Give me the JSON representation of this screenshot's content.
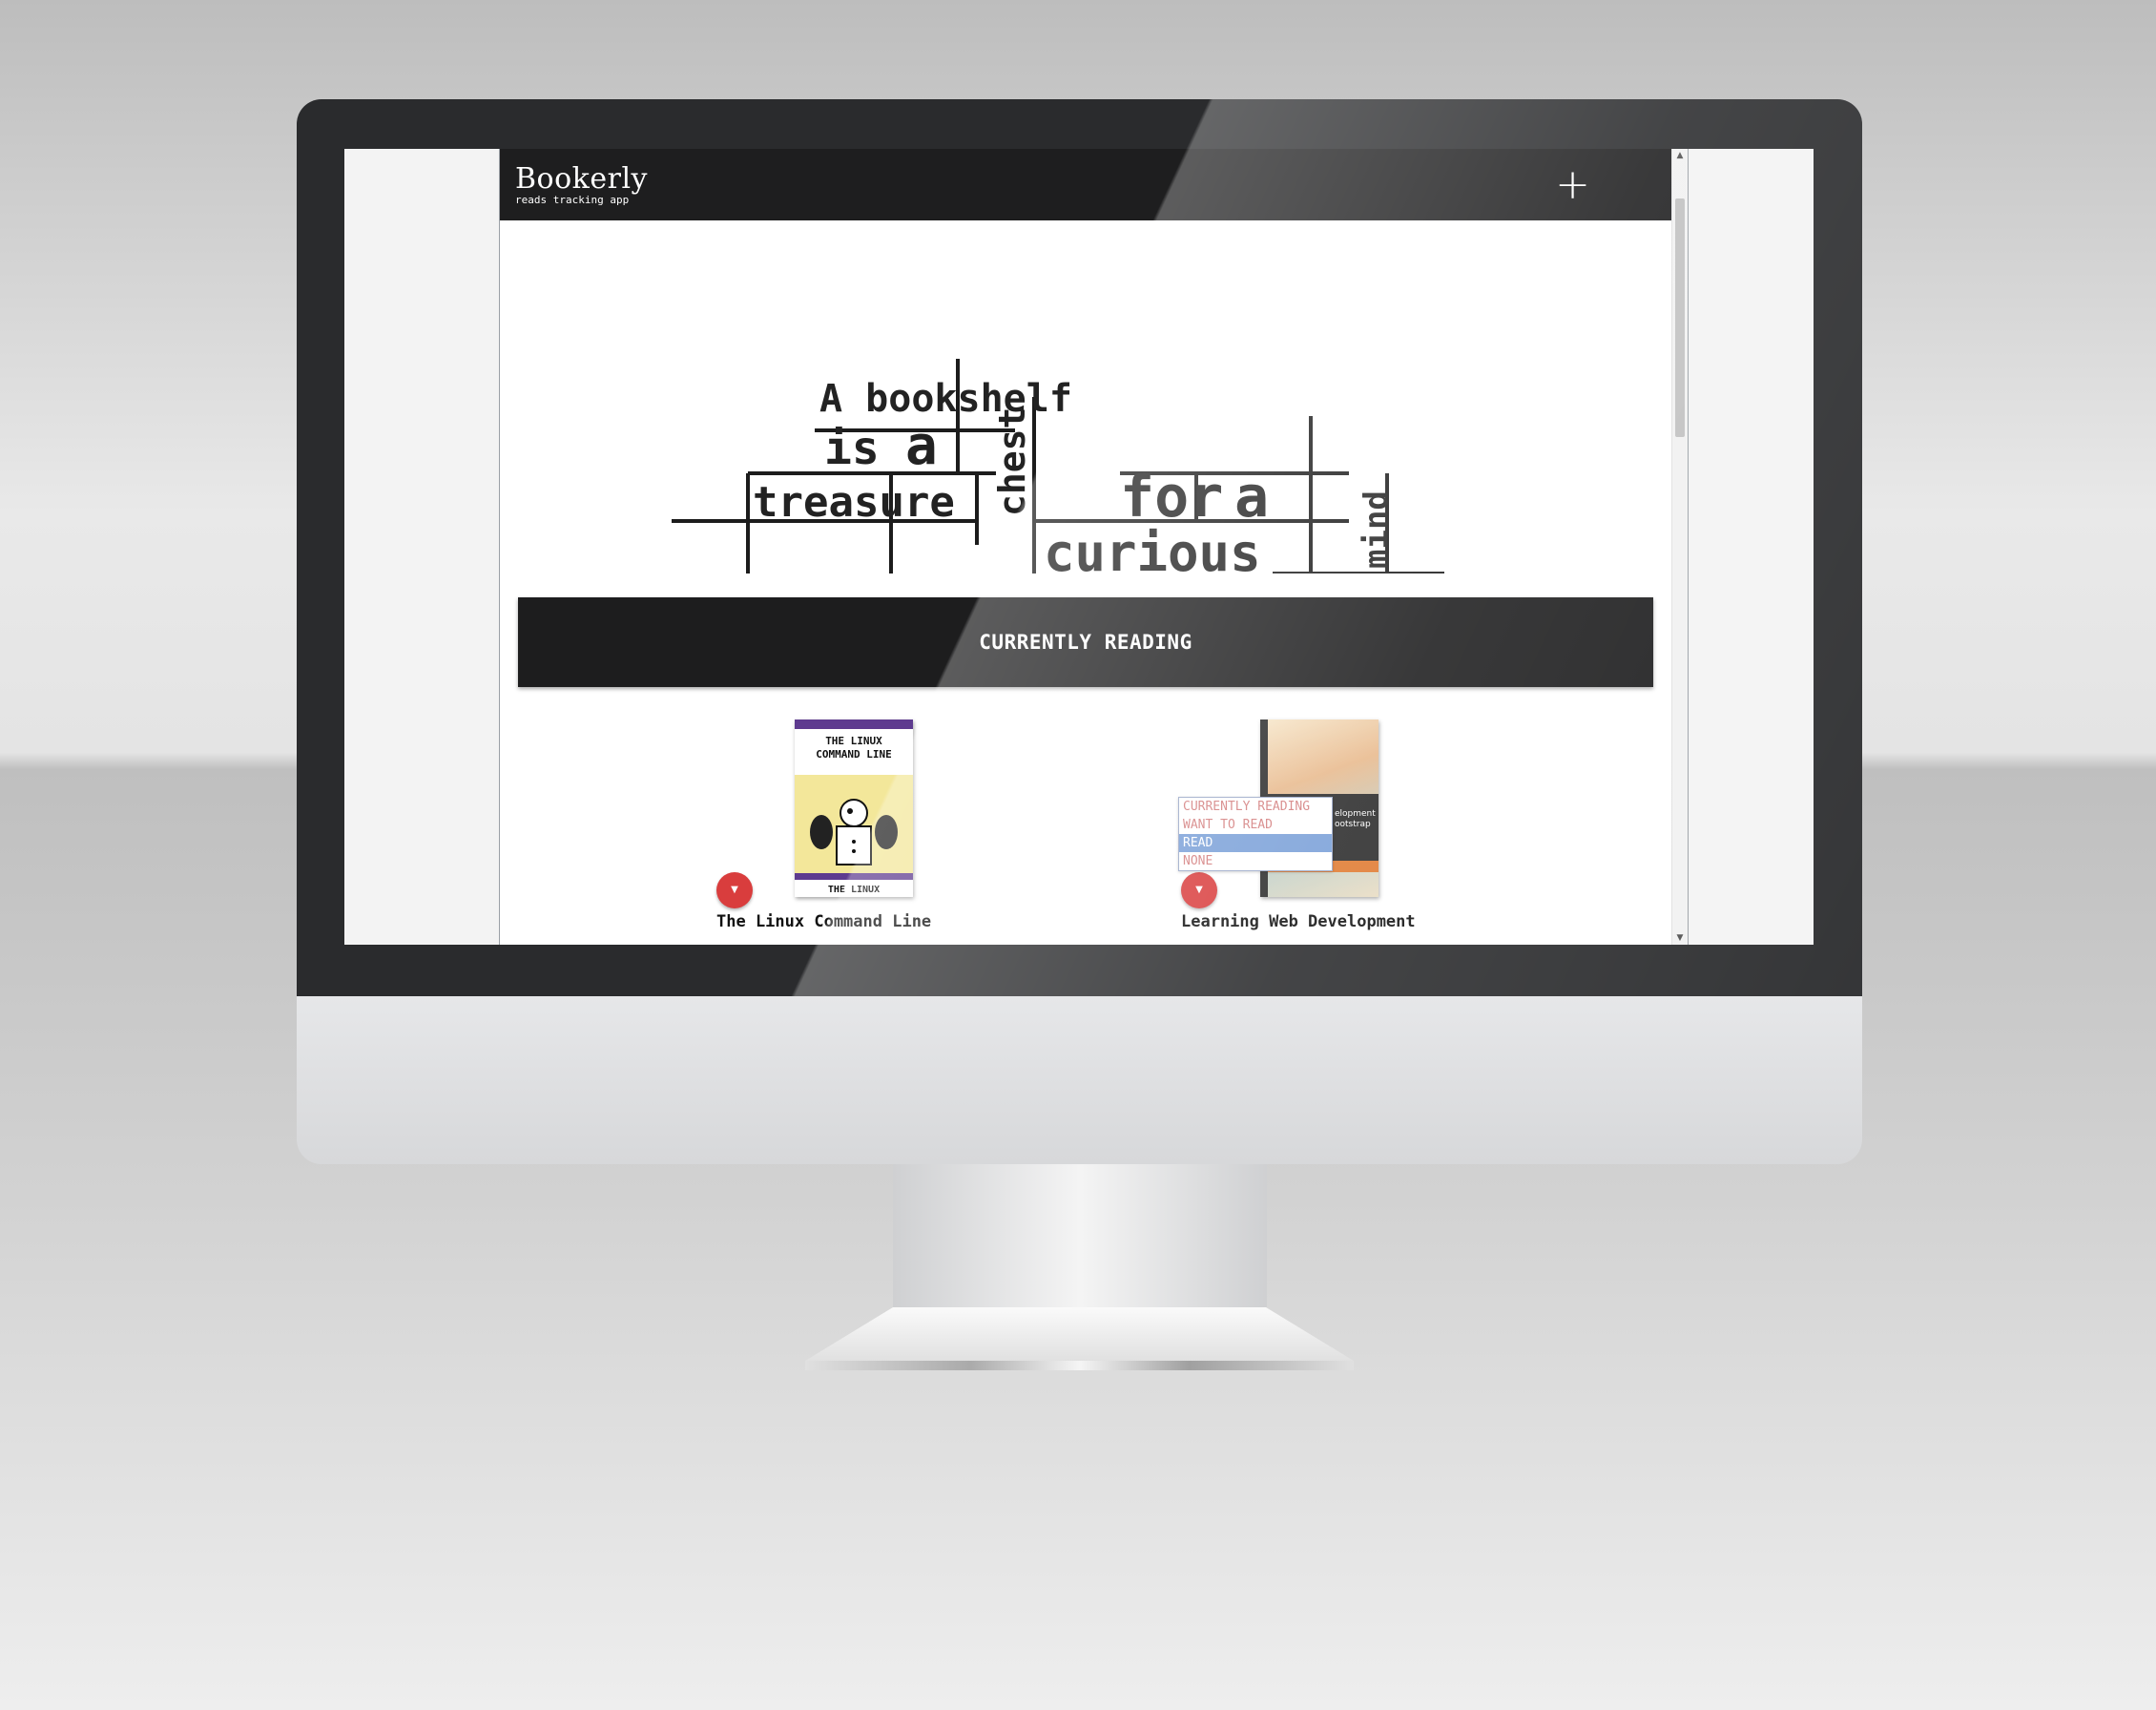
{
  "app": {
    "logo_name": "Bookerly",
    "logo_tagline": "reads tracking app",
    "add_icon": "+"
  },
  "hero": {
    "words": [
      "A bookshelf",
      "is",
      "a",
      "treasure",
      "chest",
      "for",
      "a",
      "curious",
      "mind"
    ]
  },
  "section": {
    "title": "CURRENTLY READING"
  },
  "books": [
    {
      "title": "The Linux Command Line",
      "cover_title_line1": "THE LINUX",
      "cover_title_line2": "COMMAND LINE",
      "cover_footer": "THE LINUX"
    },
    {
      "title": "Learning Web Development",
      "cover_text_line1": "elopment",
      "cover_text_line2": "ootstrap"
    }
  ],
  "shelf_menu": {
    "options": [
      "CURRENTLY READING",
      "WANT TO READ",
      "READ",
      "NONE"
    ],
    "selected": "READ"
  },
  "colors": {
    "header_bg": "#1e1e1f",
    "banner_bg": "#1d1d1e",
    "shelf_button": "#d93d3d",
    "menu_selected": "#7aa0d8",
    "menu_text": "#d47e7e"
  }
}
